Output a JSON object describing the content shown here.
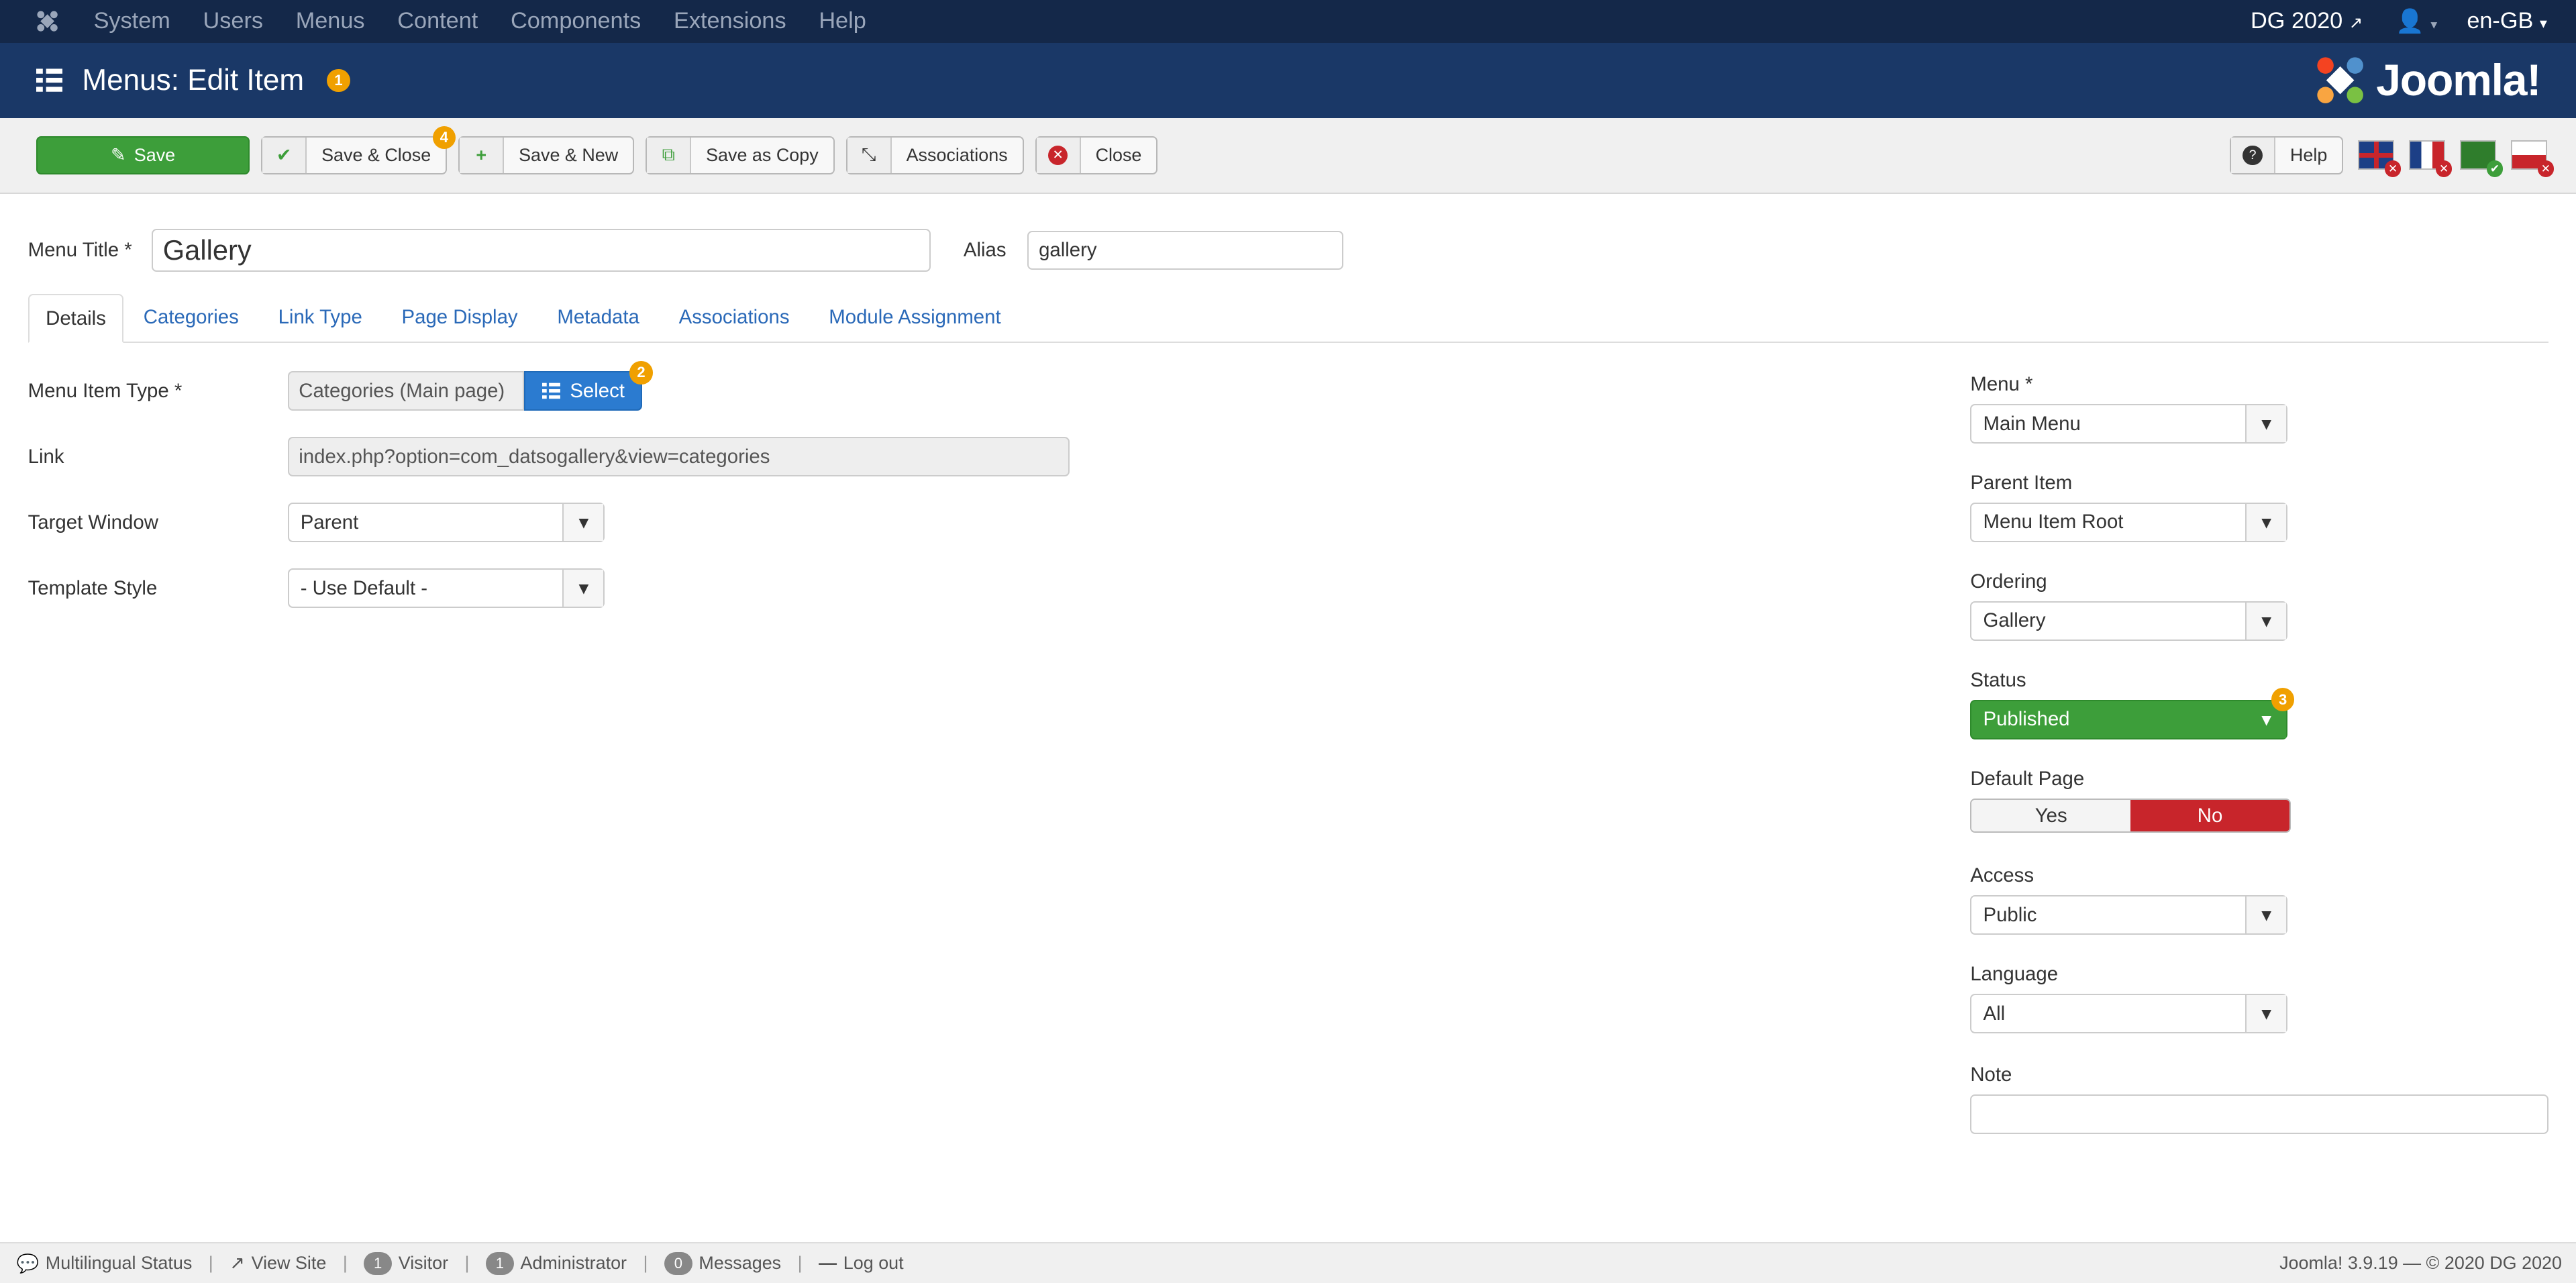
{
  "topnav": {
    "menu": [
      "System",
      "Users",
      "Menus",
      "Content",
      "Components",
      "Extensions",
      "Help"
    ],
    "site_name": "DG 2020",
    "language": "en-GB"
  },
  "header": {
    "title": "Menus: Edit Item",
    "badge": "1",
    "brand": "Joomla!"
  },
  "toolbar": {
    "save": "Save",
    "save_close": "Save & Close",
    "save_close_badge": "4",
    "save_new": "Save & New",
    "save_copy": "Save as Copy",
    "associations": "Associations",
    "close": "Close",
    "help": "Help"
  },
  "form": {
    "menu_title_label": "Menu Title *",
    "menu_title_value": "Gallery",
    "alias_label": "Alias",
    "alias_value": "gallery"
  },
  "tabs": [
    "Details",
    "Categories",
    "Link Type",
    "Page Display",
    "Metadata",
    "Associations",
    "Module Assignment"
  ],
  "details": {
    "menu_item_type_label": "Menu Item Type *",
    "menu_item_type_value": "Categories (Main page)",
    "select_label": "Select",
    "select_badge": "2",
    "link_label": "Link",
    "link_value": "index.php?option=com_datsogallery&view=categories",
    "target_window_label": "Target Window",
    "target_window_value": "Parent",
    "template_style_label": "Template Style",
    "template_style_value": "- Use Default -"
  },
  "sidebar": {
    "menu_label": "Menu *",
    "menu_value": "Main Menu",
    "parent_label": "Parent Item",
    "parent_value": "Menu Item Root",
    "ordering_label": "Ordering",
    "ordering_value": "Gallery",
    "status_label": "Status",
    "status_value": "Published",
    "status_badge": "3",
    "default_label": "Default Page",
    "default_yes": "Yes",
    "default_no": "No",
    "access_label": "Access",
    "access_value": "Public",
    "language_label": "Language",
    "language_value": "All",
    "note_label": "Note",
    "note_value": ""
  },
  "footer": {
    "multilingual": "Multilingual Status",
    "view_site": "View Site",
    "visitor_count": "1",
    "visitor": "Visitor",
    "admin_count": "1",
    "admin": "Administrator",
    "messages_count": "0",
    "messages": "Messages",
    "logout": "Log out",
    "copyright": "Joomla! 3.9.19  —  © 2020 DG 2020"
  },
  "colors": {
    "nav": "#142849",
    "header": "#1a3867",
    "save": "#3d9e3a",
    "select": "#2b7bd0",
    "no": "#c8252b",
    "badge": "#f0a000"
  }
}
